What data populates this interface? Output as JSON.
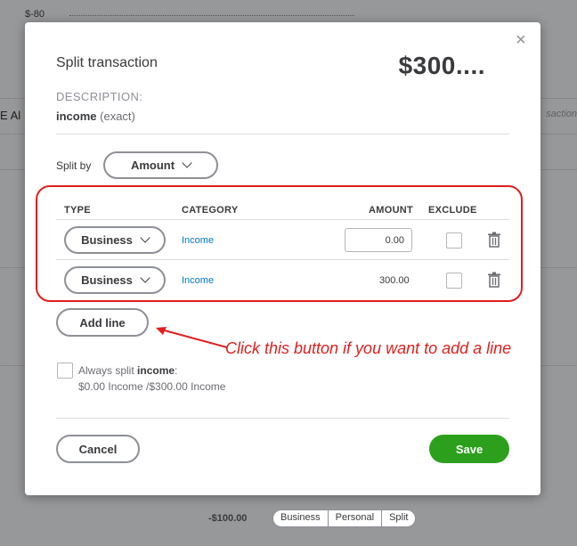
{
  "background": {
    "top_value": "$-80",
    "left_edge_text": "E Al",
    "right_edge_text": "saction",
    "bottom_amount": "-$100.00",
    "bottom_segments": [
      "Business",
      "Personal",
      "Split"
    ]
  },
  "dialog": {
    "title": "Split transaction",
    "total_amount": "$300....",
    "close_label": "×",
    "description_label": "DESCRIPTION:",
    "description_value": "income",
    "description_match": "(exact)",
    "split_by_label": "Split by",
    "split_by_value": "Amount",
    "table": {
      "headers": {
        "type": "TYPE",
        "category": "CATEGORY",
        "amount": "AMOUNT",
        "exclude": "EXCLUDE"
      },
      "rows": [
        {
          "type": "Business",
          "category": "Income",
          "amount": "0.00",
          "exclude": false
        },
        {
          "type": "Business",
          "category": "Income",
          "amount": "300.00",
          "exclude": false
        }
      ]
    },
    "add_line_label": "Add line",
    "always_split_prefix": "Always split ",
    "always_split_bold": "income",
    "always_split_suffix": ":",
    "always_split_detail": "$0.00 Income /$300.00 Income",
    "cancel_label": "Cancel",
    "save_label": "Save"
  },
  "annotation": {
    "callout_text": "Click this button if you want to add a line"
  },
  "colors": {
    "highlight": "#e01e1e",
    "link": "#0077c5",
    "save": "#2ca01c"
  },
  "icons": {
    "close": "close-icon",
    "trash": "trash-icon",
    "chevron": "chevron-down-icon",
    "arrow": "arrow-icon"
  }
}
